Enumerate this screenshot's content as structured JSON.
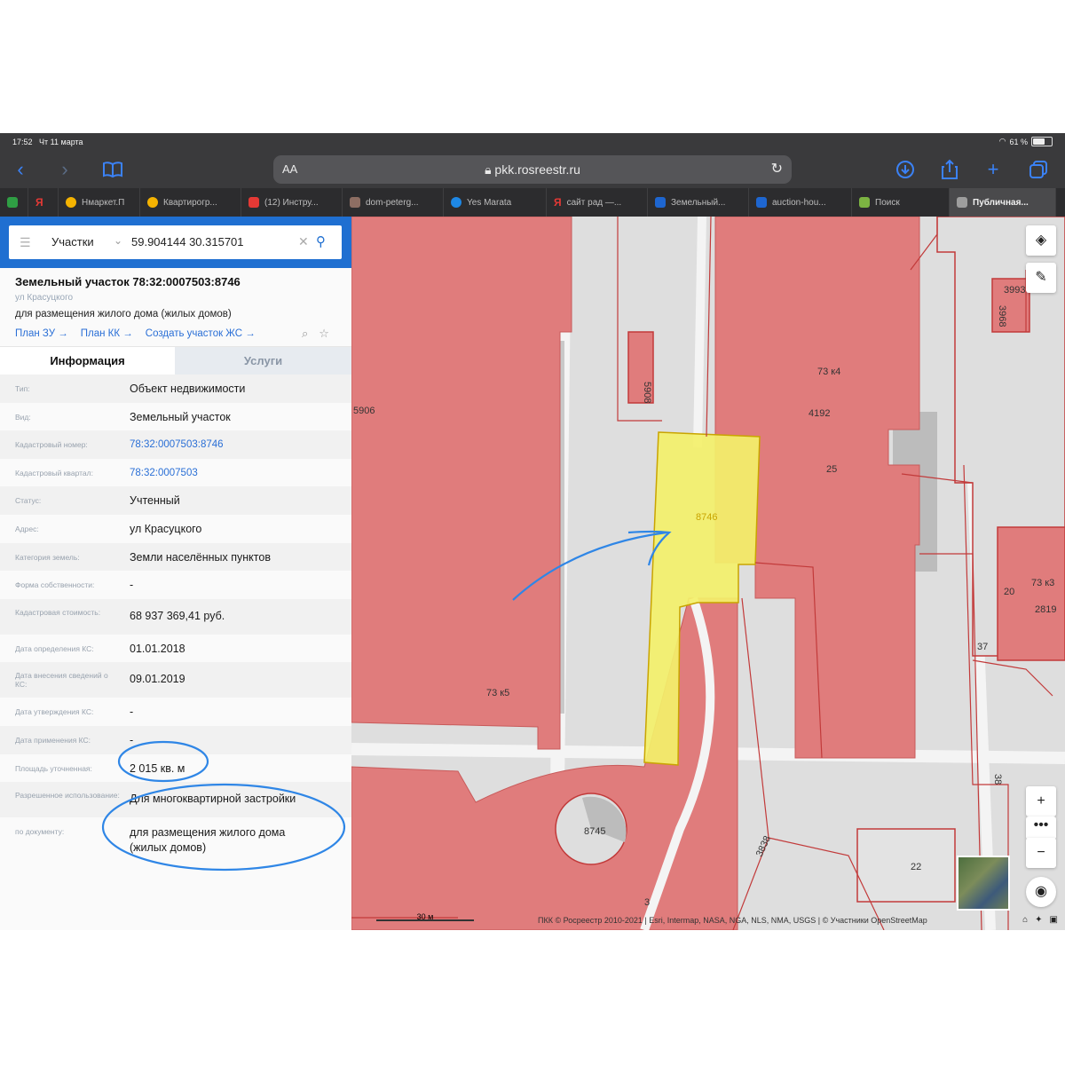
{
  "status_bar": {
    "time": "17:52",
    "date": "Чт 11 марта",
    "battery": "61 %"
  },
  "browser": {
    "aa_label": "АА",
    "url": "pkk.rosreestr.ru",
    "tabs": [
      {
        "label": "",
        "color": "#2f9e44"
      },
      {
        "label": "Я",
        "color": "#e53935"
      },
      {
        "label": "Нмаркет.П",
        "color": "#f5b301"
      },
      {
        "label": "Квартирогр...",
        "color": "#f5b301"
      },
      {
        "label": "(12) Инстру...",
        "color": "#e53935"
      },
      {
        "label": "dom-peterg...",
        "color": "#8d6e63"
      },
      {
        "label": "Yes Marata",
        "color": "#1e88e5"
      },
      {
        "label": "сайт рад —...",
        "color": "#e53935"
      },
      {
        "label": "Земельный...",
        "color": "#1e66d0"
      },
      {
        "label": "auction-hou...",
        "color": "#1e66d0"
      },
      {
        "label": "Поиск",
        "color": "#7cb342"
      },
      {
        "label": "Публичная...",
        "color": "#9e9e9e"
      }
    ]
  },
  "search": {
    "layer": "Участки",
    "query": "59.904144 30.315701"
  },
  "parcel": {
    "title": "Земельный участок 78:32:0007503:8746",
    "address": "ул Красуцкого",
    "purpose": "для размещения жилого дома (жилых домов)",
    "links": [
      "План ЗУ →",
      "План КК →",
      "Создать участок ЖС →"
    ]
  },
  "panel_tabs": {
    "info": "Информация",
    "services": "Услуги"
  },
  "rows": [
    {
      "k": "Тип:",
      "v": "Объект недвижимости"
    },
    {
      "k": "Вид:",
      "v": "Земельный участок"
    },
    {
      "k": "Кадастровый номер:",
      "v": "78:32:0007503:8746"
    },
    {
      "k": "Кадастровый квартал:",
      "v": "78:32:0007503"
    },
    {
      "k": "Статус:",
      "v": "Учтенный"
    },
    {
      "k": "Адрес:",
      "v": "ул Красуцкого"
    },
    {
      "k": "Категория земель:",
      "v": "Земли населённых пунктов"
    },
    {
      "k": "Форма собственности:",
      "v": "-"
    },
    {
      "k": "Кадастровая стоимость:",
      "v": "68 937 369,41 руб."
    },
    {
      "k": "Дата определения КС:",
      "v": "01.01.2018"
    },
    {
      "k": "Дата внесения сведений о КС:",
      "v": "09.01.2019"
    },
    {
      "k": "Дата утверждения КС:",
      "v": "-"
    },
    {
      "k": "Дата применения КС:",
      "v": "-"
    },
    {
      "k": "Площадь уточненная:",
      "v": "2 015 кв. м"
    },
    {
      "k": "Разрешенное использование:",
      "v": "Для многоквартирной застройки"
    },
    {
      "k": "по документу:",
      "v": "для размещения жилого дома (жилых домов)"
    }
  ],
  "map": {
    "labels": [
      "5906",
      "5908",
      "73 к5",
      "8746",
      "73 к4",
      "4192",
      "25",
      "8745",
      "3838",
      "3",
      "37",
      "38",
      "22",
      "20",
      "73 к3",
      "2819",
      "3993",
      "3968"
    ],
    "scale": "30 м",
    "attribution": "ПКК © Росреестр 2010-2021 | Esri, Intermap, NASA, NGA, NLS, NMA, USGS | © Участники OpenStreetMap",
    "colors": {
      "parcel": "#e07c7c",
      "selected": "#f3f06a",
      "ground": "#dedede",
      "annotation": "#2f86e6"
    }
  }
}
